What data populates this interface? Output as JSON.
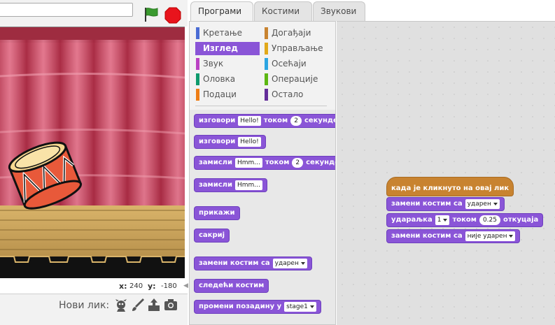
{
  "title_input": {
    "value": ""
  },
  "tabs": [
    {
      "label": "Програми",
      "active": true
    },
    {
      "label": "Костими",
      "active": false
    },
    {
      "label": "Звукови",
      "active": false
    }
  ],
  "categories": [
    {
      "label": "Кретање",
      "color": "#4a6cd4"
    },
    {
      "label": "Догађаји",
      "color": "#c88330"
    },
    {
      "label": "Изглед",
      "color": "#8a55d7",
      "selected": true
    },
    {
      "label": "Управљање",
      "color": "#e1a91a"
    },
    {
      "label": "Звук",
      "color": "#bb42c3"
    },
    {
      "label": "Осећаји",
      "color": "#2ca5e2"
    },
    {
      "label": "Оловка",
      "color": "#0e9a6c"
    },
    {
      "label": "Операције",
      "color": "#5cb712"
    },
    {
      "label": "Подаци",
      "color": "#ee7d16"
    },
    {
      "label": "Остало",
      "color": "#632d99"
    }
  ],
  "palette_blocks": {
    "say_secs": {
      "text": "изговори",
      "arg1": "Hello!",
      "mid": "током",
      "arg2": "2",
      "end": "секунде"
    },
    "say": {
      "text": "изговори",
      "arg1": "Hello!"
    },
    "think_secs": {
      "text": "замисли",
      "arg1": "Hmm...",
      "mid": "током",
      "arg2": "2",
      "end": "секунде"
    },
    "think": {
      "text": "замисли",
      "arg1": "Hmm..."
    },
    "show": {
      "text": "прикажи"
    },
    "hide": {
      "text": "сакриј"
    },
    "switch_costume": {
      "text": "замени костим са",
      "arg1": "ударен"
    },
    "next_costume": {
      "text": "следећи костим"
    },
    "switch_backdrop": {
      "text": "промени позадину у",
      "arg1": "stage1"
    }
  },
  "script": {
    "hat": "када је кликнуто на овај лик",
    "b1": {
      "text": "замени костим са",
      "arg1": "ударен"
    },
    "b2": {
      "text": "ударaљка",
      "arg1": "1",
      "mid": "током",
      "arg2": "0.25",
      "end": "откуцаја"
    },
    "b3": {
      "text": "замени костим са",
      "arg1": "није ударен"
    }
  },
  "coords": {
    "x_label": "x:",
    "x_value": "240",
    "y_label": "y:",
    "y_value": "-180"
  },
  "sprite_bar": {
    "label": "Нови лик:"
  },
  "icons": [
    "green-flag-icon",
    "stop-icon",
    "sprite-library-icon",
    "paint-brush-icon",
    "upload-icon",
    "camera-icon",
    "collapse-arrow-icon"
  ],
  "colors": {
    "looks": "#8a55d7",
    "events": "#c88330",
    "stage_curtain": "#c9485e"
  }
}
